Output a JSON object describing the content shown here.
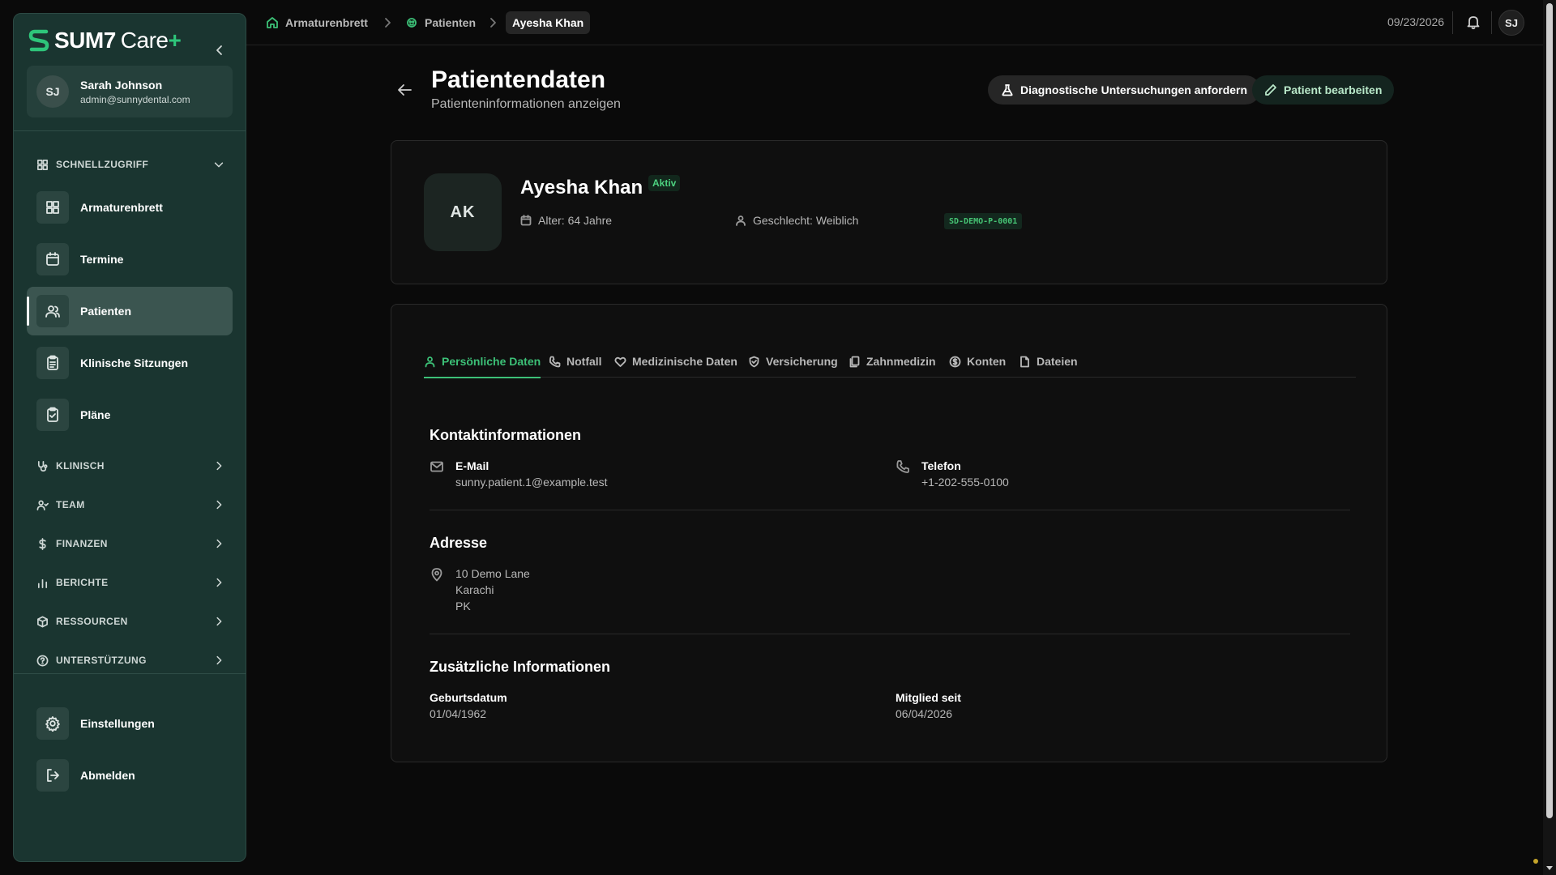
{
  "brand": {
    "name": "SUM7",
    "product": "Care",
    "plus": "+"
  },
  "user": {
    "initials": "SJ",
    "name": "Sarah Johnson",
    "email": "admin@sunnydental.com"
  },
  "sidebar": {
    "quick_access": "SCHNELLZUGRIFF",
    "items": [
      {
        "label": "Armaturenbrett",
        "icon": "dashboard-icon"
      },
      {
        "label": "Termine",
        "icon": "calendar-icon"
      },
      {
        "label": "Patienten",
        "icon": "users-icon"
      },
      {
        "label": "Klinische Sitzungen",
        "icon": "clipboard-icon"
      },
      {
        "label": "Pläne",
        "icon": "clipboard-check-icon"
      }
    ],
    "sections": [
      {
        "label": "KLINISCH",
        "icon": "stethoscope-icon"
      },
      {
        "label": "TEAM",
        "icon": "team-icon"
      },
      {
        "label": "FINANZEN",
        "icon": "dollar-icon"
      },
      {
        "label": "BERICHTE",
        "icon": "bar-chart-icon"
      },
      {
        "label": "RESSOURCEN",
        "icon": "box-icon"
      },
      {
        "label": "UNTERSTÜTZUNG",
        "icon": "help-icon"
      }
    ],
    "settings": "Einstellungen",
    "logout": "Abmelden"
  },
  "breadcrumb": {
    "home": "Armaturenbrett",
    "patients": "Patienten",
    "current": "Ayesha Khan"
  },
  "topbar": {
    "date": "09/23/2026",
    "avatar": "SJ"
  },
  "page": {
    "title": "Patientendaten",
    "subtitle": "Patienteninformationen anzeigen",
    "btn_diagnostics": "Diagnostische Untersuchungen anfordern",
    "btn_edit": "Patient bearbeiten"
  },
  "patient": {
    "initials": "AK",
    "name": "Ayesha Khan",
    "status": "Aktiv",
    "age": "Alter: 64 Jahre",
    "gender": "Geschlecht: Weiblich",
    "code": "SD-DEMO-P-0001"
  },
  "tabs": [
    {
      "label": "Persönliche Daten",
      "active": true
    },
    {
      "label": "Notfall"
    },
    {
      "label": "Medizinische Daten"
    },
    {
      "label": "Versicherung"
    },
    {
      "label": "Zahnmedizin"
    },
    {
      "label": "Konten"
    },
    {
      "label": "Dateien"
    }
  ],
  "contact": {
    "title": "Kontaktinformationen",
    "email_label": "E-Mail",
    "email": "sunny.patient.1@example.test",
    "phone_label": "Telefon",
    "phone": "+1-202-555-0100"
  },
  "address": {
    "title": "Adresse",
    "line1": "10 Demo Lane",
    "city": "Karachi",
    "country": "PK"
  },
  "additional": {
    "title": "Zusätzliche Informationen",
    "dob_label": "Geburtsdatum",
    "dob": "01/04/1962",
    "member_label": "Mitglied seit",
    "member": "06/04/2026"
  },
  "colors": {
    "accent": "#3cc077",
    "sidebar_bg": "#1a3530",
    "page_bg": "#0a0a0a"
  }
}
